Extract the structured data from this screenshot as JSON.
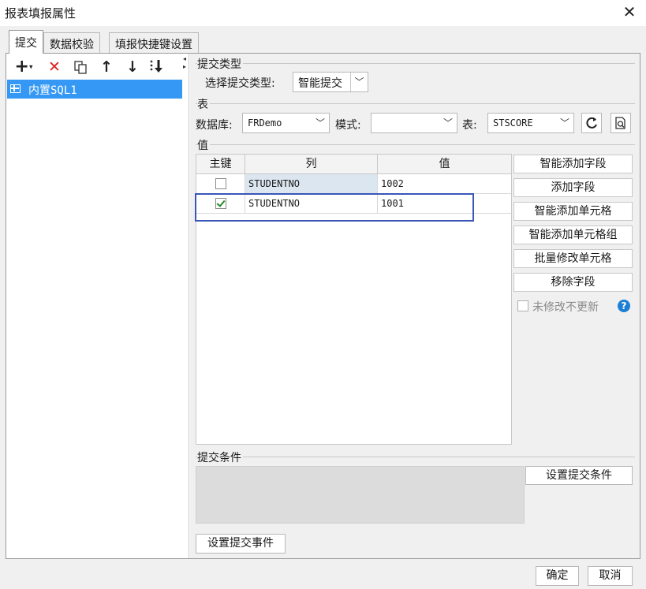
{
  "window": {
    "title": "报表填报属性"
  },
  "tabs": [
    {
      "label": "提交",
      "active": true
    },
    {
      "label": "数据校验"
    },
    {
      "label": "填报快捷键设置"
    }
  ],
  "left": {
    "toolbar": [
      "plus-icon",
      "delete-icon",
      "copy-icon",
      "up-arrow-icon",
      "down-arrow-icon",
      "move-bottom-icon"
    ],
    "tree": [
      {
        "label": "内置SQL1",
        "selected": true
      }
    ]
  },
  "submit_type": {
    "group_title": "提交类型",
    "label": "选择提交类型:",
    "value": "智能提交"
  },
  "table": {
    "group_title": "表",
    "db_label": "数据库:",
    "db_value": "FRDemo",
    "mode_label": "模式:",
    "mode_value": "",
    "table_label": "表:",
    "table_value": "STSCORE"
  },
  "value_section": {
    "title": "值",
    "columns": [
      "主键",
      "列",
      "值"
    ],
    "rows": [
      {
        "key": false,
        "column": "STUDENTNO",
        "value": "1002"
      },
      {
        "key": true,
        "column": "STUDENTNO",
        "value": "1001"
      }
    ],
    "buttons": [
      "智能添加字段",
      "添加字段",
      "智能添加单元格",
      "智能添加单元格组",
      "批量修改单元格",
      "移除字段"
    ],
    "no_update_label": "未修改不更新"
  },
  "condition": {
    "title": "提交条件",
    "set_button": "设置提交条件"
  },
  "event_button": "设置提交事件",
  "footer": {
    "ok": "确定",
    "cancel": "取消"
  },
  "colors": {
    "selection": "#3598f4",
    "highlight_border": "#3a56b8",
    "delete_red": "#e02020",
    "check_green": "#2a8a2a",
    "help_blue": "#1c7fd6"
  }
}
